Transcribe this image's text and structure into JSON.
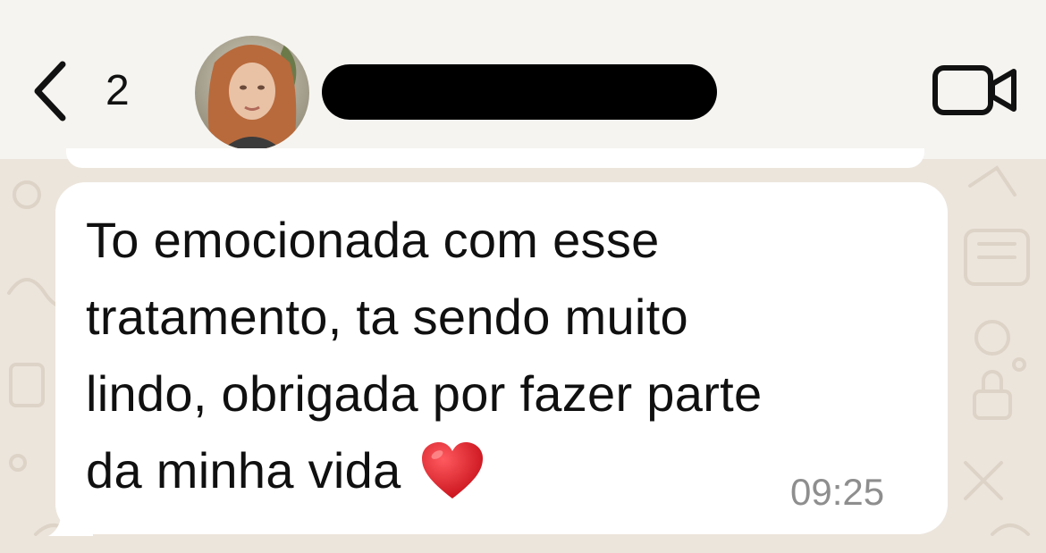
{
  "header": {
    "back_count": "2",
    "contact_name_redacted": true
  },
  "message": {
    "lines": [
      "To emocionada com esse",
      "tratamento, ta sendo muito",
      "lindo, obrigada por fazer parte",
      "da minha vida"
    ],
    "emoji": "heart-emoji",
    "time": "09:25"
  },
  "colors": {
    "header_bg": "#f5f4f0",
    "wallpaper_bg": "#ece5dc",
    "bubble_bg": "#ffffff",
    "time_text": "#8e8e8e",
    "heart": "#e0242b"
  }
}
